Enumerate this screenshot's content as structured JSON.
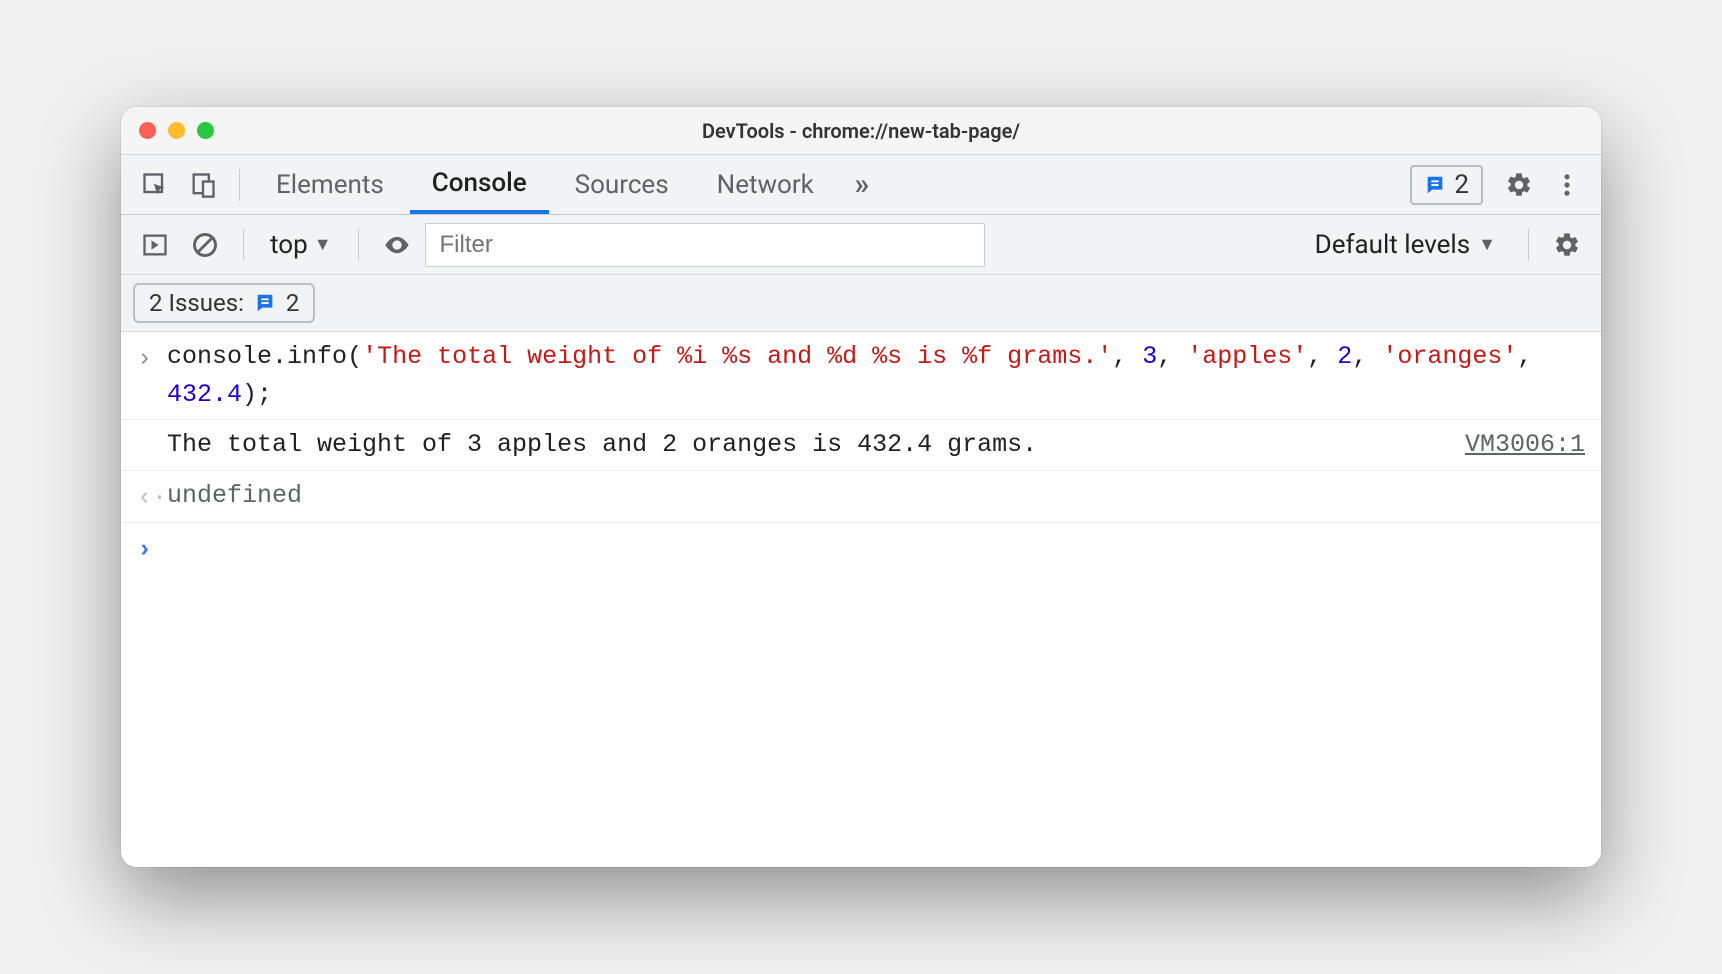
{
  "window": {
    "title": "DevTools - chrome://new-tab-page/"
  },
  "tabs": {
    "items": [
      "Elements",
      "Console",
      "Sources",
      "Network"
    ],
    "active": "Console",
    "more_glyph": "»"
  },
  "issues_badge": {
    "count": "2"
  },
  "console_toolbar": {
    "context": "top",
    "filter_placeholder": "Filter",
    "levels": "Default levels"
  },
  "issues_row": {
    "label": "2 Issues:",
    "count": "2"
  },
  "console": {
    "input": {
      "tokens": [
        {
          "t": "method",
          "v": "console"
        },
        {
          "t": "plain",
          "v": "."
        },
        {
          "t": "method",
          "v": "info"
        },
        {
          "t": "plain",
          "v": "("
        },
        {
          "t": "str",
          "v": "'The total weight of %i %s and %d %s is %f grams.'"
        },
        {
          "t": "plain",
          "v": ", "
        },
        {
          "t": "num",
          "v": "3"
        },
        {
          "t": "plain",
          "v": ", "
        },
        {
          "t": "str",
          "v": "'apples'"
        },
        {
          "t": "plain",
          "v": ", "
        },
        {
          "t": "num",
          "v": "2"
        },
        {
          "t": "plain",
          "v": ", "
        },
        {
          "t": "str",
          "v": "'oranges'"
        },
        {
          "t": "plain",
          "v": ", "
        },
        {
          "t": "num",
          "v": "432.4"
        },
        {
          "t": "plain",
          "v": ");"
        }
      ]
    },
    "output": {
      "message": "The total weight of 3 apples and 2 oranges is 432.4 grams.",
      "source": "VM3006:1"
    },
    "return_value": "undefined"
  }
}
